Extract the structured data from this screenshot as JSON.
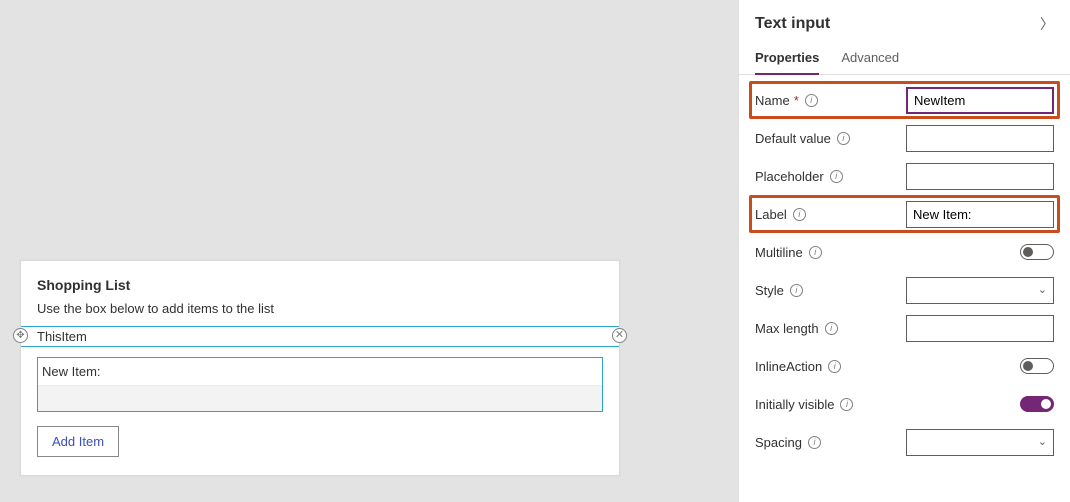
{
  "canvas": {
    "card_title": "Shopping List",
    "card_description": "Use the box below to add items to the list",
    "selection_name": "ThisItem",
    "field_label": "New Item:",
    "field_value": "",
    "add_button_label": "Add Item"
  },
  "panel": {
    "title": "Text input",
    "tabs": {
      "properties": "Properties",
      "advanced": "Advanced"
    },
    "rows": {
      "name": {
        "label": "Name",
        "value": "NewItem",
        "required": true,
        "highlighted": true
      },
      "default_value": {
        "label": "Default value",
        "value": ""
      },
      "placeholder": {
        "label": "Placeholder",
        "value": ""
      },
      "label": {
        "label": "Label",
        "value": "New Item:",
        "highlighted": true
      },
      "multiline": {
        "label": "Multiline",
        "on": false
      },
      "style": {
        "label": "Style",
        "value": ""
      },
      "max_length": {
        "label": "Max length",
        "value": ""
      },
      "inline_action": {
        "label": "InlineAction",
        "on": false
      },
      "initially_visible": {
        "label": "Initially visible",
        "on": true
      },
      "spacing": {
        "label": "Spacing",
        "value": ""
      }
    }
  }
}
